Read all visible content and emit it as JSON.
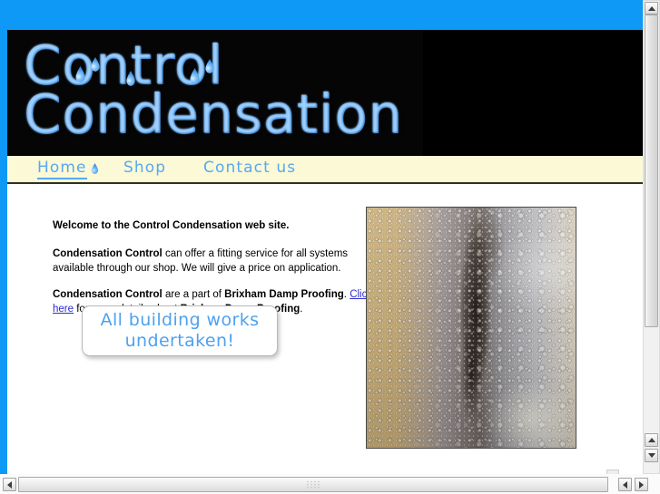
{
  "site": {
    "title": "Control Condensation",
    "logo": {
      "line1": "Control",
      "line2": "Condensation",
      "drop_icon_name": "water-drop-icon"
    },
    "colors": {
      "page_background": "#0d99f5",
      "header_background": "#000000",
      "nav_background": "#fcf9d6",
      "logo_blue": "#4aa6f0",
      "nav_link": "#57a8f2",
      "body_link": "#2a2ad0",
      "promo_text": "#4da2f0",
      "content_background": "#ffffff"
    }
  },
  "nav": {
    "items": [
      {
        "label": "Home",
        "active": true
      },
      {
        "label": "Shop",
        "active": false
      },
      {
        "label": "Contact us",
        "active": false
      }
    ]
  },
  "content": {
    "welcome": "Welcome to the Control Condensation web site.",
    "paragraph2": {
      "brand": "Condensation Control",
      "rest": " can offer a fitting service for all systems available through our shop. We will give a price on application."
    },
    "paragraph3": {
      "brand": "Condensation Control",
      "mid1": " are a part of ",
      "partner": "Brixham Damp Proofing",
      "mid2": ". ",
      "link": "Click here",
      "mid3": " for more details about ",
      "partner2": "Brixham Damp Proofing",
      "end": "."
    },
    "promo": {
      "line1": "All building works",
      "line2": "undertaken!"
    },
    "photo": {
      "alt": "Condensation droplets on window with black mould streak"
    }
  },
  "scrollbars": {
    "vertical": {
      "up_arrow": "▲",
      "down_arrow": "▼"
    },
    "horizontal": {
      "left_arrow": "◀",
      "right_arrow": "▶"
    }
  }
}
